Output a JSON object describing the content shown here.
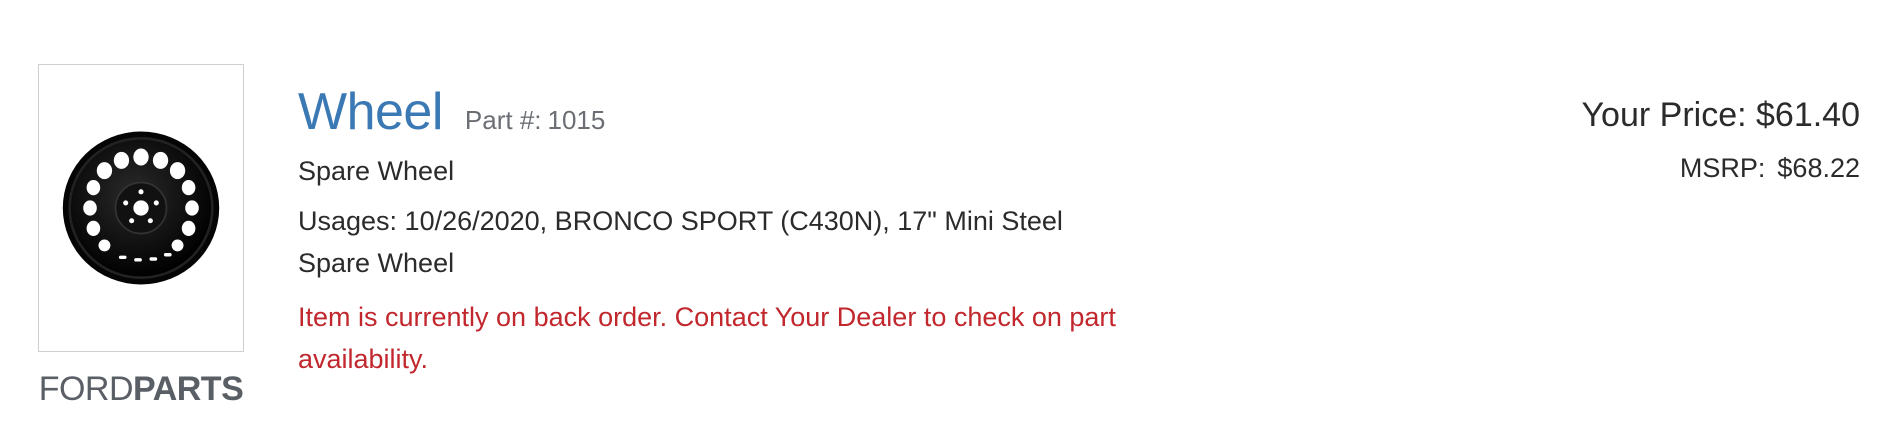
{
  "product": {
    "title": "Wheel",
    "part_label": "Part #:",
    "part_number": "1015",
    "description": "Spare Wheel",
    "usages": "Usages: 10/26/2020, BRONCO SPORT (C430N), 17\" Mini Steel Spare Wheel",
    "availability_notice": "Item is currently on back order. Contact Your Dealer to check on part availability.",
    "image_icon": "steel-wheel-icon"
  },
  "brand": {
    "word1": "FORD",
    "word2": "PARTS"
  },
  "pricing": {
    "your_price": "Your Price: $61.40",
    "msrp_label": "MSRP:",
    "msrp_value": "$68.22"
  },
  "colors": {
    "title": "#3b79b4",
    "notice": "#c1272d",
    "text": "#2b2b2b",
    "muted": "#6b6f75"
  }
}
